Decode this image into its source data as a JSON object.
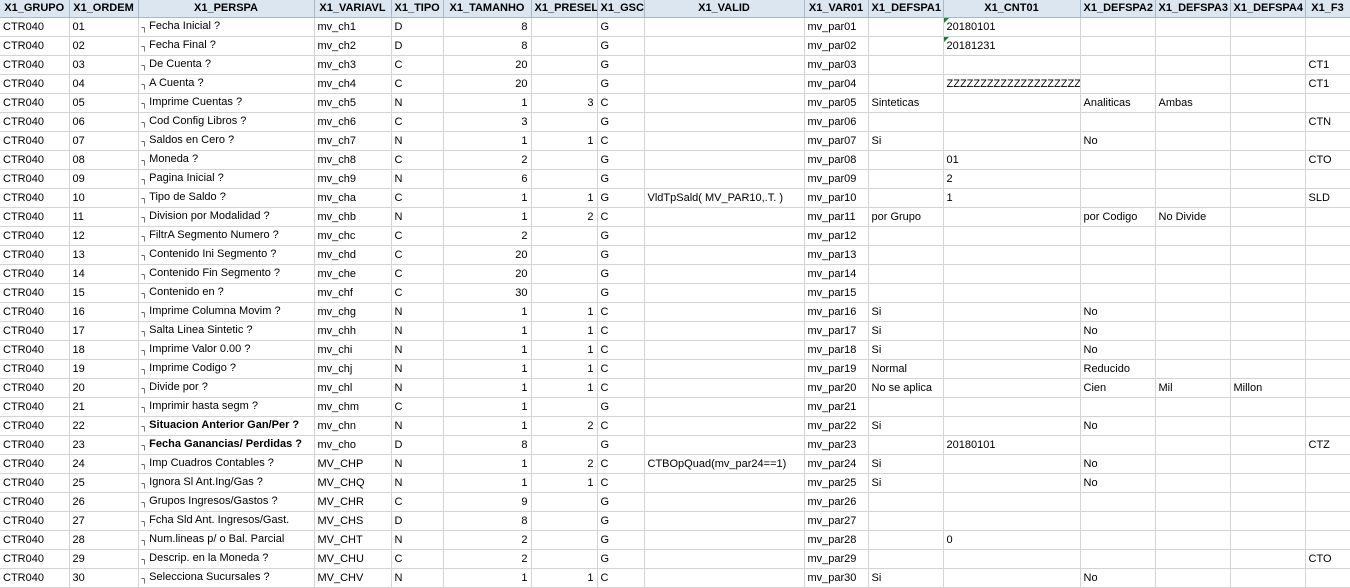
{
  "columns": [
    "X1_GRUPO",
    "X1_ORDEM",
    "X1_PERSPA",
    "X1_VARIAVL",
    "X1_TIPO",
    "X1_TAMANHO",
    "X1_PRESEL",
    "X1_GSC",
    "X1_VALID",
    "X1_VAR01",
    "X1_DEFSPA1",
    "X1_CNT01",
    "X1_DEFSPA2",
    "X1_DEFSPA3",
    "X1_DEFSPA4",
    "X1_F3"
  ],
  "rows": [
    {
      "grupo": "CTR040",
      "ordem": "01",
      "perspa": "Fecha Inicial ?",
      "variavl": "mv_ch1",
      "tipo": "D",
      "tamanho": "8",
      "presel": "",
      "gsc": "G",
      "valid": "",
      "var01": "mv_par01",
      "defspa1": "",
      "cnt01": "20180101",
      "defspa2": "",
      "defspa3": "",
      "defspa4": "",
      "f3": ""
    },
    {
      "grupo": "CTR040",
      "ordem": "02",
      "perspa": "Fecha Final ?",
      "variavl": "mv_ch2",
      "tipo": "D",
      "tamanho": "8",
      "presel": "",
      "gsc": "G",
      "valid": "",
      "var01": "mv_par02",
      "defspa1": "",
      "cnt01": "20181231",
      "defspa2": "",
      "defspa3": "",
      "defspa4": "",
      "f3": ""
    },
    {
      "grupo": "CTR040",
      "ordem": "03",
      "perspa": "De Cuenta ?",
      "variavl": "mv_ch3",
      "tipo": "C",
      "tamanho": "20",
      "presel": "",
      "gsc": "G",
      "valid": "",
      "var01": "mv_par03",
      "defspa1": "",
      "cnt01": "",
      "defspa2": "",
      "defspa3": "",
      "defspa4": "",
      "f3": "CT1"
    },
    {
      "grupo": "CTR040",
      "ordem": "04",
      "perspa": "A Cuenta ?",
      "variavl": "mv_ch4",
      "tipo": "C",
      "tamanho": "20",
      "presel": "",
      "gsc": "G",
      "valid": "",
      "var01": "mv_par04",
      "defspa1": "",
      "cnt01": "ZZZZZZZZZZZZZZZZZZZZ",
      "defspa2": "",
      "defspa3": "",
      "defspa4": "",
      "f3": "CT1"
    },
    {
      "grupo": "CTR040",
      "ordem": "05",
      "perspa": "Imprime Cuentas ?",
      "variavl": "mv_ch5",
      "tipo": "N",
      "tamanho": "1",
      "presel": "3",
      "gsc": "C",
      "valid": "",
      "var01": "mv_par05",
      "defspa1": "Sinteticas",
      "cnt01": "",
      "defspa2": "Analiticas",
      "defspa3": "Ambas",
      "defspa4": "",
      "f3": ""
    },
    {
      "grupo": "CTR040",
      "ordem": "06",
      "perspa": "Cod Config Libros ?",
      "variavl": "mv_ch6",
      "tipo": "C",
      "tamanho": "3",
      "presel": "",
      "gsc": "G",
      "valid": "",
      "var01": "mv_par06",
      "defspa1": "",
      "cnt01": "",
      "defspa2": "",
      "defspa3": "",
      "defspa4": "",
      "f3": "CTN"
    },
    {
      "grupo": "CTR040",
      "ordem": "07",
      "perspa": "Saldos en Cero ?",
      "variavl": "mv_ch7",
      "tipo": "N",
      "tamanho": "1",
      "presel": "1",
      "gsc": "C",
      "valid": "",
      "var01": "mv_par07",
      "defspa1": "Si",
      "cnt01": "",
      "defspa2": "No",
      "defspa3": "",
      "defspa4": "",
      "f3": ""
    },
    {
      "grupo": "CTR040",
      "ordem": "08",
      "perspa": "Moneda ?",
      "variavl": "mv_ch8",
      "tipo": "C",
      "tamanho": "2",
      "presel": "",
      "gsc": "G",
      "valid": "",
      "var01": "mv_par08",
      "defspa1": "",
      "cnt01": "01",
      "defspa2": "",
      "defspa3": "",
      "defspa4": "",
      "f3": "CTO"
    },
    {
      "grupo": "CTR040",
      "ordem": "09",
      "perspa": "Pagina Inicial ?",
      "variavl": "mv_ch9",
      "tipo": "N",
      "tamanho": "6",
      "presel": "",
      "gsc": "G",
      "valid": "",
      "var01": "mv_par09",
      "defspa1": "",
      "cnt01": "2",
      "defspa2": "",
      "defspa3": "",
      "defspa4": "",
      "f3": ""
    },
    {
      "grupo": "CTR040",
      "ordem": "10",
      "perspa": "Tipo de Saldo ?",
      "variavl": "mv_cha",
      "tipo": "C",
      "tamanho": "1",
      "presel": "1",
      "gsc": "G",
      "valid": "VldTpSald( MV_PAR10,.T. )",
      "var01": "mv_par10",
      "defspa1": "",
      "cnt01": "1",
      "defspa2": "",
      "defspa3": "",
      "defspa4": "",
      "f3": "SLD"
    },
    {
      "grupo": "CTR040",
      "ordem": "11",
      "perspa": "Division por Modalidad ?",
      "variavl": "mv_chb",
      "tipo": "N",
      "tamanho": "1",
      "presel": "2",
      "gsc": "C",
      "valid": "",
      "var01": "mv_par11",
      "defspa1": "por Grupo",
      "cnt01": "",
      "defspa2": "por Codigo",
      "defspa3": "No Divide",
      "defspa4": "",
      "f3": ""
    },
    {
      "grupo": "CTR040",
      "ordem": "12",
      "perspa": "FiltrA Segmento Numero ?",
      "variavl": "mv_chc",
      "tipo": "C",
      "tamanho": "2",
      "presel": "",
      "gsc": "G",
      "valid": "",
      "var01": "mv_par12",
      "defspa1": "",
      "cnt01": "",
      "defspa2": "",
      "defspa3": "",
      "defspa4": "",
      "f3": ""
    },
    {
      "grupo": "CTR040",
      "ordem": "13",
      "perspa": "Contenido Ini Segmento ?",
      "variavl": "mv_chd",
      "tipo": "C",
      "tamanho": "20",
      "presel": "",
      "gsc": "G",
      "valid": "",
      "var01": "mv_par13",
      "defspa1": "",
      "cnt01": "",
      "defspa2": "",
      "defspa3": "",
      "defspa4": "",
      "f3": ""
    },
    {
      "grupo": "CTR040",
      "ordem": "14",
      "perspa": "Contenido Fin Segmento ?",
      "variavl": "mv_che",
      "tipo": "C",
      "tamanho": "20",
      "presel": "",
      "gsc": "G",
      "valid": "",
      "var01": "mv_par14",
      "defspa1": "",
      "cnt01": "",
      "defspa2": "",
      "defspa3": "",
      "defspa4": "",
      "f3": ""
    },
    {
      "grupo": "CTR040",
      "ordem": "15",
      "perspa": "Contenido en ?",
      "variavl": "mv_chf",
      "tipo": "C",
      "tamanho": "30",
      "presel": "",
      "gsc": "G",
      "valid": "",
      "var01": "mv_par15",
      "defspa1": "",
      "cnt01": "",
      "defspa2": "",
      "defspa3": "",
      "defspa4": "",
      "f3": ""
    },
    {
      "grupo": "CTR040",
      "ordem": "16",
      "perspa": "Imprime Columna Movim ?",
      "variavl": "mv_chg",
      "tipo": "N",
      "tamanho": "1",
      "presel": "1",
      "gsc": "C",
      "valid": "",
      "var01": "mv_par16",
      "defspa1": "Si",
      "cnt01": "",
      "defspa2": "No",
      "defspa3": "",
      "defspa4": "",
      "f3": ""
    },
    {
      "grupo": "CTR040",
      "ordem": "17",
      "perspa": "Salta Linea Sintetic ?",
      "variavl": "mv_chh",
      "tipo": "N",
      "tamanho": "1",
      "presel": "1",
      "gsc": "C",
      "valid": "",
      "var01": "mv_par17",
      "defspa1": "Si",
      "cnt01": "",
      "defspa2": "No",
      "defspa3": "",
      "defspa4": "",
      "f3": ""
    },
    {
      "grupo": "CTR040",
      "ordem": "18",
      "perspa": "Imprime Valor 0.00 ?",
      "variavl": "mv_chi",
      "tipo": "N",
      "tamanho": "1",
      "presel": "1",
      "gsc": "C",
      "valid": "",
      "var01": "mv_par18",
      "defspa1": "Si",
      "cnt01": "",
      "defspa2": "No",
      "defspa3": "",
      "defspa4": "",
      "f3": ""
    },
    {
      "grupo": "CTR040",
      "ordem": "19",
      "perspa": "Imprime Codigo ?",
      "variavl": "mv_chj",
      "tipo": "N",
      "tamanho": "1",
      "presel": "1",
      "gsc": "C",
      "valid": "",
      "var01": "mv_par19",
      "defspa1": "Normal",
      "cnt01": "",
      "defspa2": "Reducido",
      "defspa3": "",
      "defspa4": "",
      "f3": ""
    },
    {
      "grupo": "CTR040",
      "ordem": "20",
      "perspa": "Divide por ?",
      "variavl": "mv_chl",
      "tipo": "N",
      "tamanho": "1",
      "presel": "1",
      "gsc": "C",
      "valid": "",
      "var01": "mv_par20",
      "defspa1": "No se aplica",
      "cnt01": "",
      "defspa2": "Cien",
      "defspa3": "Mil",
      "defspa4": "Millon",
      "f3": ""
    },
    {
      "grupo": "CTR040",
      "ordem": "21",
      "perspa": "Imprimir hasta segm ?",
      "variavl": "mv_chm",
      "tipo": "C",
      "tamanho": "1",
      "presel": "",
      "gsc": "G",
      "valid": "",
      "var01": "mv_par21",
      "defspa1": "",
      "cnt01": "",
      "defspa2": "",
      "defspa3": "",
      "defspa4": "",
      "f3": ""
    },
    {
      "grupo": "CTR040",
      "ordem": "22",
      "perspa": "Situacion Anterior Gan/Per ?",
      "variavl": "mv_chn",
      "tipo": "N",
      "tamanho": "1",
      "presel": "2",
      "gsc": "C",
      "valid": "",
      "var01": "mv_par22",
      "defspa1": "Si",
      "cnt01": "",
      "defspa2": "No",
      "defspa3": "",
      "defspa4": "",
      "f3": "",
      "bold": true
    },
    {
      "grupo": "CTR040",
      "ordem": "23",
      "perspa": "Fecha Ganancias/ Perdidas ?",
      "variavl": "mv_cho",
      "tipo": "D",
      "tamanho": "8",
      "presel": "",
      "gsc": "G",
      "valid": "",
      "var01": "mv_par23",
      "defspa1": "",
      "cnt01": "20180101",
      "defspa2": "",
      "defspa3": "",
      "defspa4": "",
      "f3": "CTZ",
      "bold": true
    },
    {
      "grupo": "CTR040",
      "ordem": "24",
      "perspa": "Imp Cuadros Contables ?",
      "variavl": "MV_CHP",
      "tipo": "N",
      "tamanho": "1",
      "presel": "2",
      "gsc": "C",
      "valid": "CTBOpQuad(mv_par24==1)",
      "var01": "mv_par24",
      "defspa1": "Si",
      "cnt01": "",
      "defspa2": "No",
      "defspa3": "",
      "defspa4": "",
      "f3": ""
    },
    {
      "grupo": "CTR040",
      "ordem": "25",
      "perspa": "Ignora Sl Ant.Ing/Gas ?",
      "variavl": "MV_CHQ",
      "tipo": "N",
      "tamanho": "1",
      "presel": "1",
      "gsc": "C",
      "valid": "",
      "var01": "mv_par25",
      "defspa1": "Si",
      "cnt01": "",
      "defspa2": "No",
      "defspa3": "",
      "defspa4": "",
      "f3": ""
    },
    {
      "grupo": "CTR040",
      "ordem": "26",
      "perspa": "Grupos Ingresos/Gastos ?",
      "variavl": "MV_CHR",
      "tipo": "C",
      "tamanho": "9",
      "presel": "",
      "gsc": "G",
      "valid": "",
      "var01": "mv_par26",
      "defspa1": "",
      "cnt01": "",
      "defspa2": "",
      "defspa3": "",
      "defspa4": "",
      "f3": ""
    },
    {
      "grupo": "CTR040",
      "ordem": "27",
      "perspa": "Fcha Sld Ant. Ingresos/Gast.",
      "variavl": "MV_CHS",
      "tipo": "D",
      "tamanho": "8",
      "presel": "",
      "gsc": "G",
      "valid": "",
      "var01": "mv_par27",
      "defspa1": "",
      "cnt01": "",
      "defspa2": "",
      "defspa3": "",
      "defspa4": "",
      "f3": ""
    },
    {
      "grupo": "CTR040",
      "ordem": "28",
      "perspa": "Num.lineas p/ o Bal. Parcial",
      "variavl": "MV_CHT",
      "tipo": "N",
      "tamanho": "2",
      "presel": "",
      "gsc": "G",
      "valid": "",
      "var01": "mv_par28",
      "defspa1": "",
      "cnt01": "0",
      "defspa2": "",
      "defspa3": "",
      "defspa4": "",
      "f3": ""
    },
    {
      "grupo": "CTR040",
      "ordem": "29",
      "perspa": "Descrip. en la Moneda ?",
      "variavl": "MV_CHU",
      "tipo": "C",
      "tamanho": "2",
      "presel": "",
      "gsc": "G",
      "valid": "",
      "var01": "mv_par29",
      "defspa1": "",
      "cnt01": "",
      "defspa2": "",
      "defspa3": "",
      "defspa4": "",
      "f3": "CTO"
    },
    {
      "grupo": "CTR040",
      "ordem": "30",
      "perspa": "Selecciona Sucursales ?",
      "variavl": "MV_CHV",
      "tipo": "N",
      "tamanho": "1",
      "presel": "1",
      "gsc": "C",
      "valid": "",
      "var01": "mv_par30",
      "defspa1": "Si",
      "cnt01": "",
      "defspa2": "No",
      "defspa3": "",
      "defspa4": "",
      "f3": ""
    }
  ]
}
